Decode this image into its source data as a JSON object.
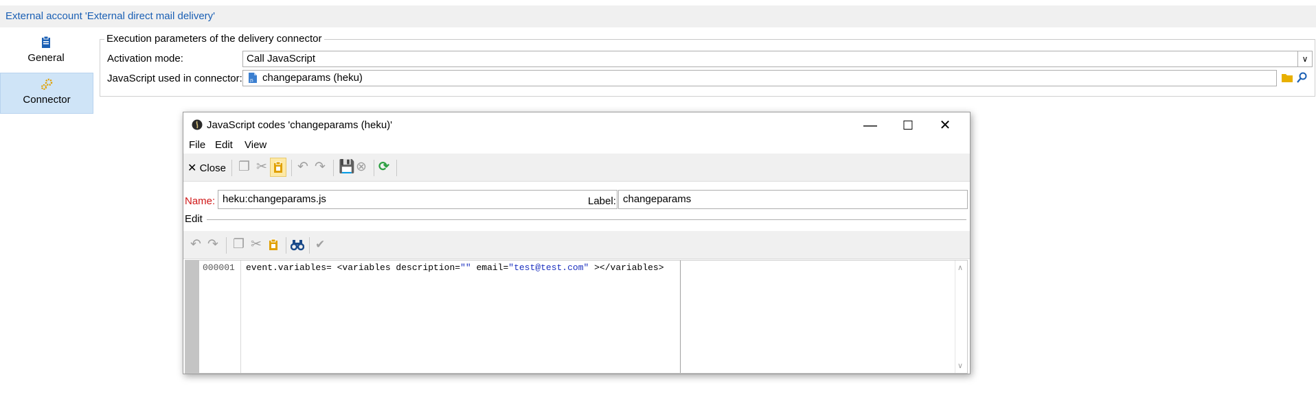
{
  "header": {
    "title": "External account 'External direct mail delivery'"
  },
  "nav": {
    "items": [
      {
        "label": "General",
        "icon": "clipboard-icon"
      },
      {
        "label": "Connector",
        "icon": "gears-icon"
      }
    ]
  },
  "execution": {
    "legend": "Execution parameters of the delivery connector",
    "activation_label": "Activation mode:",
    "activation_value": "Call JavaScript",
    "script_label": "JavaScript used in connector:",
    "script_value": "changeparams (heku)"
  },
  "dialog": {
    "title": "JavaScript codes 'changeparams (heku)'",
    "menu": [
      "File",
      "Edit",
      "View"
    ],
    "toolbar": {
      "close_label": "Close"
    },
    "name_label": "Name:",
    "name_value": "heku:changeparams.js",
    "label_label": "Label:",
    "label_value": "changeparams",
    "edit_label": "Edit",
    "editor": {
      "line_number": "000001",
      "code_prefix": "event.variables= <variables description=",
      "code_str1": "\"\"",
      "code_mid": " email=",
      "code_str2": "\"test@test.com\"",
      "code_suffix": " ></variables>"
    }
  },
  "colors": {
    "accent": "#1a5fb4",
    "selected_nav": "#cfe4f7",
    "required_label": "#d01818",
    "refresh_green": "#2ea043",
    "paste_orange": "#e0a000"
  }
}
